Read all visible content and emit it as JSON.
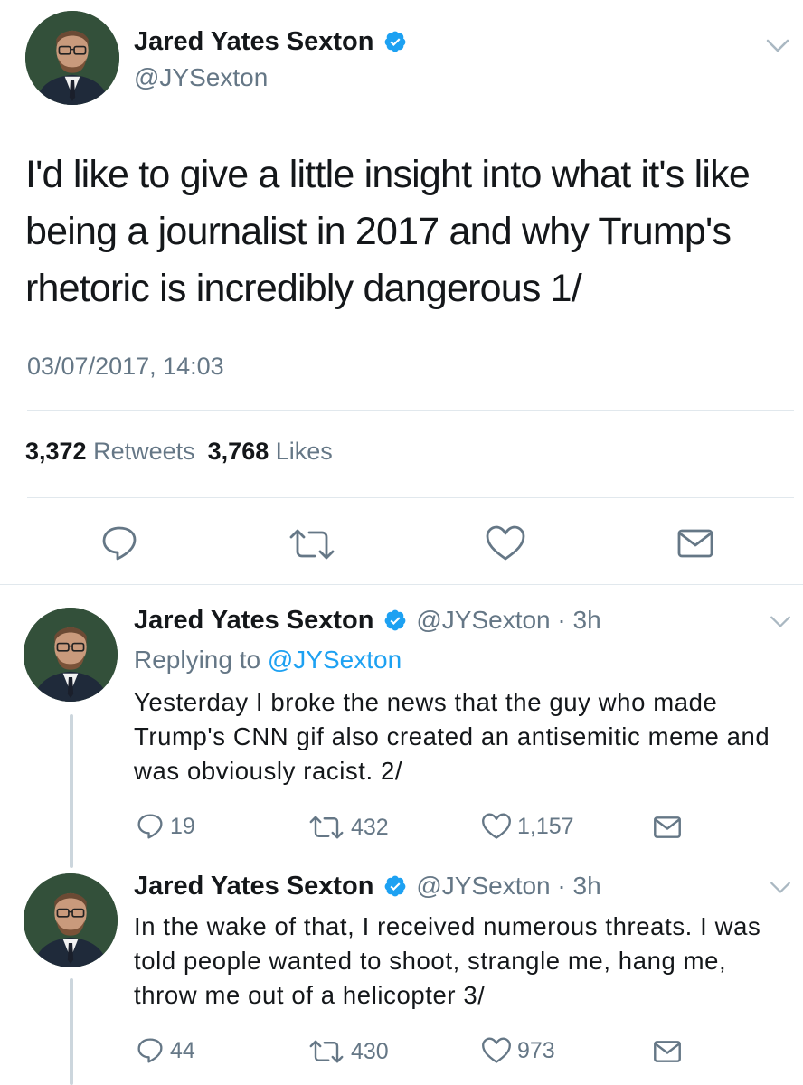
{
  "main_tweet": {
    "author_name": "Jared Yates Sexton",
    "handle": "@JYSexton",
    "text": "I'd like to give a little insight into what it's like being a journalist in 2017 and why Trump's rhetoric is incredibly dangerous 1/",
    "timestamp": "03/07/2017, 14:03",
    "retweet_count": "3,372",
    "retweet_label": "Retweets",
    "like_count": "3,768",
    "like_label": "Likes"
  },
  "replies": [
    {
      "author_name": "Jared Yates Sexton",
      "handle_time": "@JYSexton · 3h",
      "replying_prefix": "Replying to",
      "replying_to": "@JYSexton",
      "text": "Yesterday I broke the news that the guy who made Trump's CNN gif also created an antisemitic meme and was obviously racist. 2/",
      "reply_count": "19",
      "retweet_count": "432",
      "like_count": "1,157"
    },
    {
      "author_name": "Jared Yates Sexton",
      "handle_time": "@JYSexton · 3h",
      "text": "In the wake of that, I received numerous threats. I was told people wanted to shoot, strangle me, hang me, throw me out of a helicopter 3/",
      "reply_count": "44",
      "retweet_count": "430",
      "like_count": "973"
    }
  ],
  "colors": {
    "accent": "#1da1f2",
    "secondary_text": "#657786",
    "icon": "#657786",
    "divider": "#e1e8ed"
  },
  "icons": [
    "verified-badge-icon",
    "chevron-down-icon",
    "reply-icon",
    "retweet-icon",
    "like-icon",
    "direct-message-icon"
  ]
}
